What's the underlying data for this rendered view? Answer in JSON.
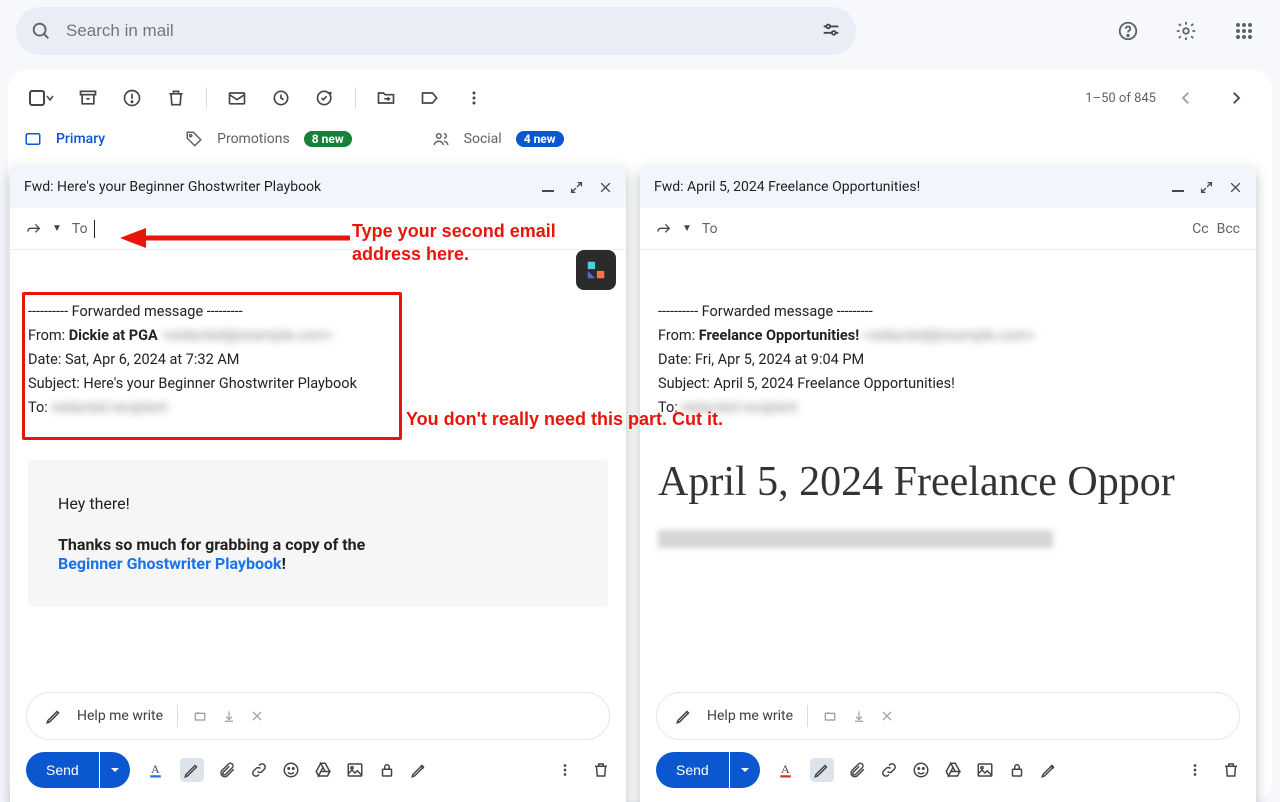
{
  "search": {
    "placeholder": "Search in mail"
  },
  "pagination": {
    "text": "1–50 of 845"
  },
  "tabs": {
    "primary": "Primary",
    "promotions": "Promotions",
    "promotions_badge": "8 new",
    "social": "Social",
    "social_badge": "4 new"
  },
  "annotation1": "Type your second email address here.",
  "annotation2": "You don't really need this part. Cut it.",
  "help_me_write": "Help me write",
  "send": "Send",
  "to_label": "To",
  "cc": "Cc",
  "bcc": "Bcc",
  "compose_left": {
    "subject": "Fwd: Here's your Beginner Ghostwriter Playbook",
    "fwd_header": "---------- Forwarded message ---------",
    "from_label": "From: ",
    "from_name": "Dickie at PGA",
    "from_email_redacted": "<redacted@example.com>",
    "date_line": "Date: Sat, Apr 6, 2024 at 7:32 AM",
    "subject_line": "Subject: Here's your Beginner Ghostwriter Playbook",
    "to_line_label": "To: ",
    "to_redacted": "redacted recipient",
    "body_greeting": "Hey there!",
    "body_line1": "Thanks so much for grabbing a copy of the ",
    "body_link": "Beginner Ghostwriter Playbook",
    "body_exclaim": "!"
  },
  "compose_right": {
    "subject": "Fwd: April 5, 2024 Freelance Opportunities!",
    "fwd_header": "---------- Forwarded message ---------",
    "from_label": "From: ",
    "from_name": "Freelance Opportunities!",
    "from_email_redacted": "<redacted@example.com>",
    "date_line": "Date: Fri, Apr 5, 2024 at 9:04 PM",
    "subject_line": "Subject: April 5, 2024 Freelance Opportunities!",
    "to_line_label": "To: ",
    "to_redacted": "redacted recipient",
    "big_title": "April 5, 2024 Freelance Oppor"
  }
}
